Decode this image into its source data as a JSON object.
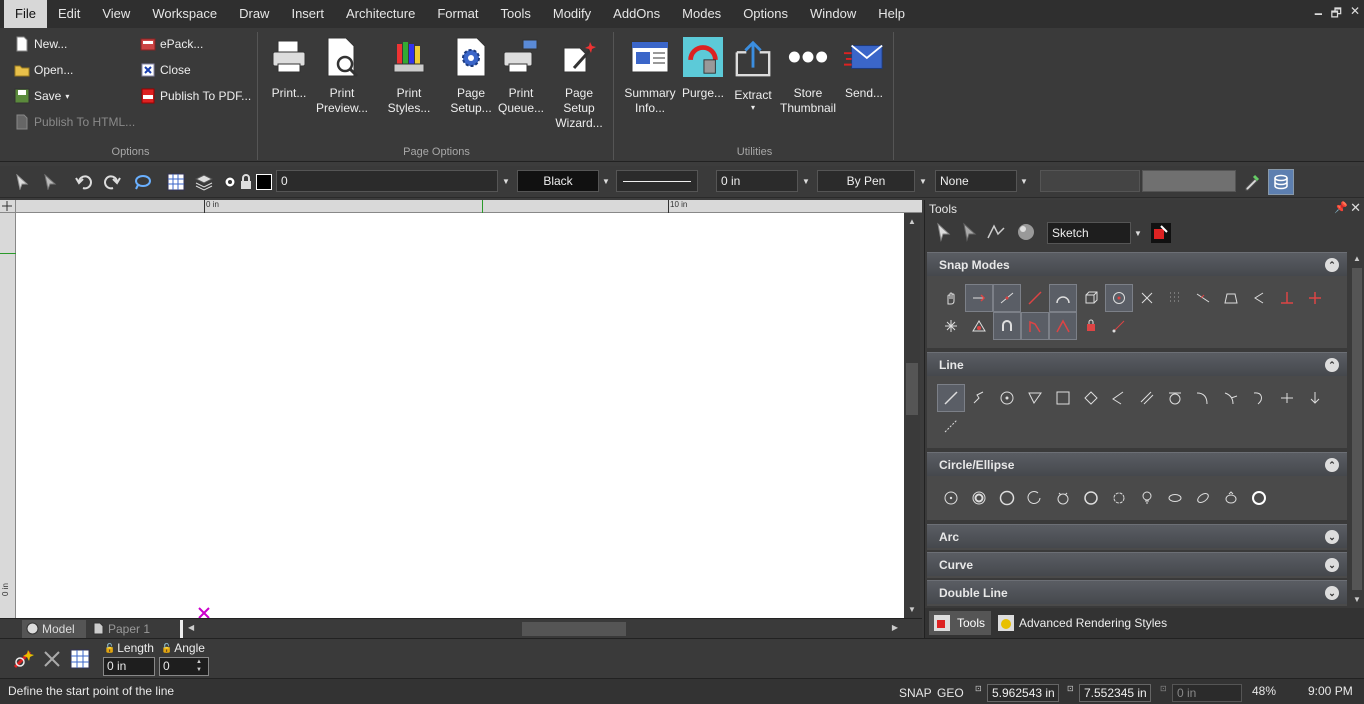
{
  "menubar": {
    "items": [
      "File",
      "Edit",
      "View",
      "Workspace",
      "Draw",
      "Insert",
      "Architecture",
      "Format",
      "Tools",
      "Modify",
      "AddOns",
      "Modes",
      "Options",
      "Window",
      "Help"
    ],
    "active": "File"
  },
  "ribbon": {
    "options": {
      "label": "Options",
      "new": "New...",
      "open": "Open...",
      "save": "Save",
      "publish_html": "Publish To HTML...",
      "epack": "ePack...",
      "close": "Close",
      "publish_pdf": "Publish To PDF..."
    },
    "page_options": {
      "label": "Page Options",
      "print": "Print...",
      "print_preview_1": "Print",
      "print_preview_2": "Preview...",
      "print_styles": "Print Styles...",
      "page_setup_1": "Page",
      "page_setup_2": "Setup...",
      "print_queue_1": "Print",
      "print_queue_2": "Queue...",
      "wizard_1": "Page Setup",
      "wizard_2": "Wizard..."
    },
    "utilities": {
      "label": "Utilities",
      "summary_1": "Summary",
      "summary_2": "Info...",
      "purge": "Purge...",
      "extract": "Extract",
      "thumb_1": "Store",
      "thumb_2": "Thumbnail",
      "send": "Send..."
    }
  },
  "toolbar2": {
    "layer": "0",
    "color": "Black",
    "line_width": "0 in",
    "pen": "By Pen",
    "fill": "None"
  },
  "ruler": {
    "mark0": "0 in",
    "mark10": "10 in",
    "vmark": "0 in"
  },
  "doc_tabs": {
    "model": "Model",
    "paper": "Paper 1"
  },
  "tools_panel": {
    "title": "Tools",
    "workspace": "Sketch",
    "sections": {
      "snap": "Snap Modes",
      "line": "Line",
      "circle": "Circle/Ellipse",
      "arc": "Arc",
      "curve": "Curve",
      "double_line": "Double Line"
    },
    "bottom_tabs": {
      "tools": "Tools",
      "rendering": "Advanced Rendering Styles"
    }
  },
  "inspector": {
    "length_label": "Length",
    "length_value": "0 in",
    "angle_label": "Angle",
    "angle_value": "0"
  },
  "status": {
    "prompt": "Define the start point of the line",
    "snap": "SNAP",
    "geo": "GEO",
    "x": "5.962543 in",
    "y": "7.552345 in",
    "z": "0 in",
    "zoom": "48%",
    "time": "9:00 PM"
  }
}
